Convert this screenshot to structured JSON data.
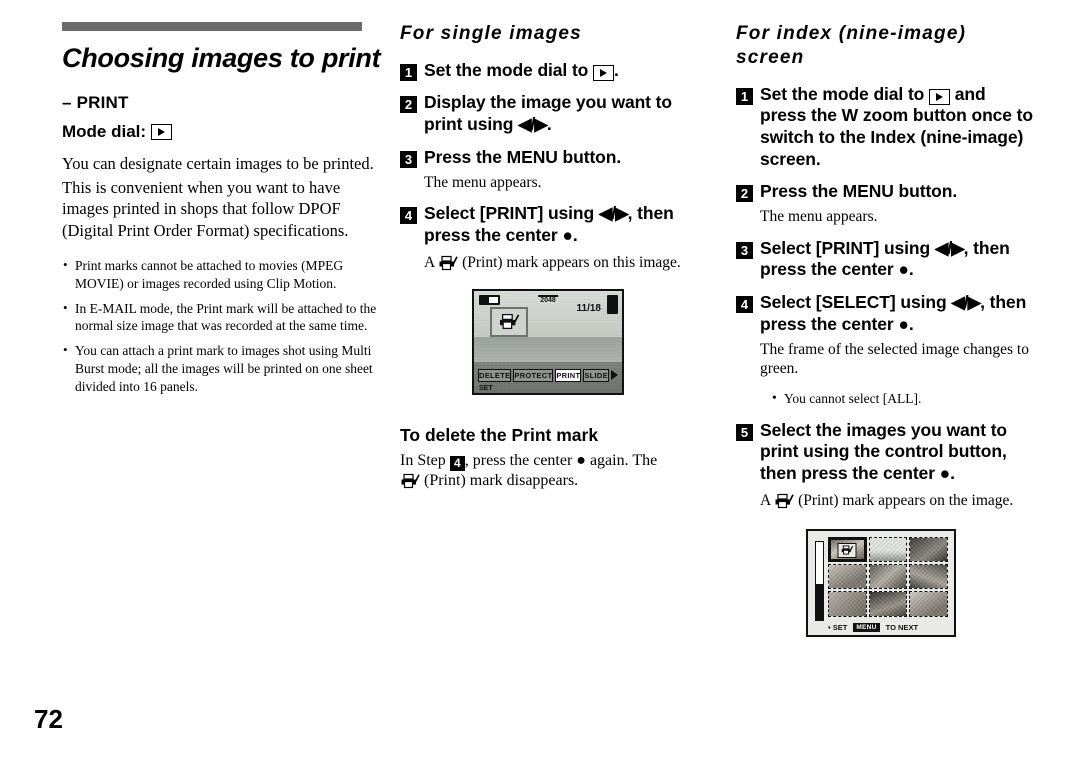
{
  "page_number": "72",
  "left": {
    "title": "Choosing images to print",
    "subtitle": "– PRINT",
    "mode_dial_label": "Mode dial:",
    "mode_dial_icon": "play-icon",
    "paragraphs": [
      "You can designate certain images to be printed.",
      "This is convenient when you want to have images printed in shops that follow DPOF (Digital Print Order Format) specifications."
    ],
    "bullets": [
      "Print marks cannot be attached to movies (MPEG MOVIE) or images recorded using Clip Motion.",
      "In E-MAIL mode, the Print mark will be attached to the normal size image that was recorded at the same time.",
      "You can attach a print mark to images shot using Multi Burst mode; all the images will be printed on one sheet divided into 16 panels."
    ]
  },
  "middle": {
    "heading": "For single images",
    "steps": [
      {
        "num": "1",
        "text_before": "Set the mode dial to ",
        "icon": "play-icon",
        "text_after": "."
      },
      {
        "num": "2",
        "text_before": "Display the image you want to print using ",
        "icon": "left-right-arrows",
        "text_after": "."
      },
      {
        "num": "3",
        "text_before": "Press the MENU button.",
        "icon": "",
        "text_after": "",
        "note": "The menu appears."
      },
      {
        "num": "4",
        "text_before": "Select [PRINT] using ",
        "icon": "left-right-arrows",
        "text_after": ", then press the center ●."
      }
    ],
    "step4_note_prefix": "A",
    "step4_note_icon": "print-mark-icon",
    "step4_note_suffix": "(Print) mark appears on this image.",
    "step3_note": "The menu appears.",
    "lcd": {
      "battery_icon": "battery-icon",
      "image_size": "2048",
      "counter": "11/18",
      "print_mark_icon": "print-mark-icon",
      "menu_items": [
        "DELETE",
        "PROTECT",
        "PRINT",
        "SLIDE"
      ],
      "selected_menu_item": "PRINT",
      "next_icon": "next-arrow-icon",
      "set_label": "SET"
    },
    "delete_heading": "To delete the Print mark",
    "delete_text_1": "In Step",
    "delete_step_num": "4",
    "delete_text_2": ", press the center ● again. The",
    "delete_icon": "print-mark-icon",
    "delete_text_3": "(Print) mark disappears."
  },
  "right": {
    "heading": "For index (nine-image) screen",
    "steps": [
      {
        "num": "1",
        "text_before": "Set the mode dial to ",
        "icon": "play-icon",
        "text_after": " and press the W zoom button once to switch to the Index (nine-image) screen."
      },
      {
        "num": "2",
        "text_before": "Press the MENU button.",
        "icon": "",
        "text_after": "",
        "note": "The menu appears."
      },
      {
        "num": "3",
        "text_before": "Select [PRINT] using ",
        "icon": "left-right-arrows",
        "text_after": ", then press the center ●."
      },
      {
        "num": "4",
        "text_before": "Select [SELECT] using ",
        "icon": "left-right-arrows",
        "text_after": ", then press the center ●."
      },
      {
        "num": "5",
        "text_before": "Select the images you want to print using the control button, then press the center ●.",
        "icon": "",
        "text_after": ""
      }
    ],
    "step2_note": "The menu appears.",
    "step4_note": "The frame of the selected image changes to green.",
    "step4_subbullet": "You cannot select [ALL].",
    "step5_note_prefix": "A",
    "step5_note_icon": "print-mark-icon",
    "step5_note_suffix": "(Print) mark appears on the image.",
    "index_screen": {
      "selected_cell": 1,
      "print_mark_icon": "print-mark-icon",
      "set_label": "SET",
      "menu_badge": "MENU",
      "next_label": "TO NEXT"
    }
  },
  "colors": {
    "rule": "#6b6b6b",
    "text": "#000000",
    "step_badge_bg": "#000000",
    "step_badge_fg": "#ffffff"
  }
}
